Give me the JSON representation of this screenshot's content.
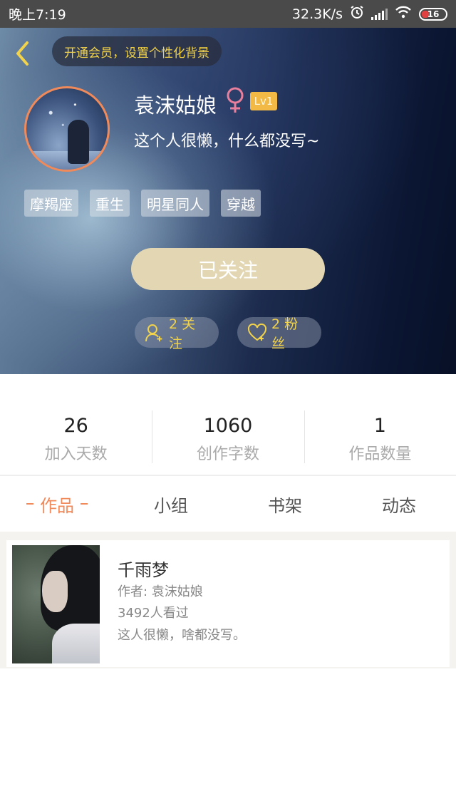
{
  "status_bar": {
    "time": "晚上7:19",
    "network_speed": "32.3K/s",
    "battery": "16"
  },
  "header": {
    "member_prompt": "开通会员，设置个性化背景"
  },
  "profile": {
    "username": "袁沫姑娘",
    "level": "Lv1",
    "signature": "这个人很懒，什么都没写~",
    "tags": [
      "摩羯座",
      "重生",
      "明星同人",
      "穿越"
    ],
    "follow_button": "已关注",
    "following": "2 关注",
    "fans": "2 粉丝"
  },
  "stats": [
    {
      "value": "26",
      "label": "加入天数"
    },
    {
      "value": "1060",
      "label": "创作字数"
    },
    {
      "value": "1",
      "label": "作品数量"
    }
  ],
  "tabs": [
    {
      "label": "作品",
      "active": true
    },
    {
      "label": "小组",
      "active": false
    },
    {
      "label": "书架",
      "active": false
    },
    {
      "label": "动态",
      "active": false
    }
  ],
  "works": [
    {
      "title": "千雨梦",
      "author": "作者: 袁沫姑娘",
      "views": "3492人看过",
      "description": "这人很懒，啥都没写。"
    }
  ],
  "colors": {
    "accent_orange": "#f08a5a",
    "gold_text": "#f2d34a",
    "follow_button_bg": "#e2d7b2",
    "level_badge": "#f2b945",
    "gender_icon": "#e87f9c"
  }
}
